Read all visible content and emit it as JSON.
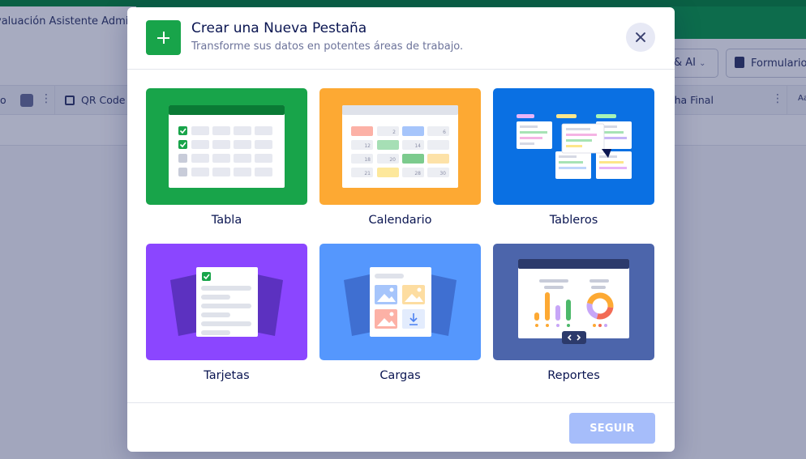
{
  "background": {
    "tab_title": "valuación Asistente Admin...",
    "toolbar": {
      "ai_button": "& AI",
      "forms_button": "Formulario"
    },
    "columns": {
      "first": "o",
      "qr": "QR Code",
      "end_date": "echa Final",
      "last": "Aa"
    }
  },
  "modal": {
    "title": "Crear una Nueva Pestaña",
    "subtitle": "Transforme sus datos en potentes áreas de trabajo.",
    "options": [
      {
        "label": "Tabla",
        "color": "#18a44a"
      },
      {
        "label": "Calendario",
        "color": "#fda933"
      },
      {
        "label": "Tableros",
        "color": "#0a70e3"
      },
      {
        "label": "Tarjetas",
        "color": "#8b46ff"
      },
      {
        "label": "Cargas",
        "color": "#5597fd"
      },
      {
        "label": "Reportes",
        "color": "#4c65ab"
      }
    ],
    "calendar_numbers": [
      "2",
      "6",
      "12",
      "14",
      "18",
      "20",
      "21",
      "28",
      "30"
    ],
    "continue_button": "SEGUIR"
  }
}
